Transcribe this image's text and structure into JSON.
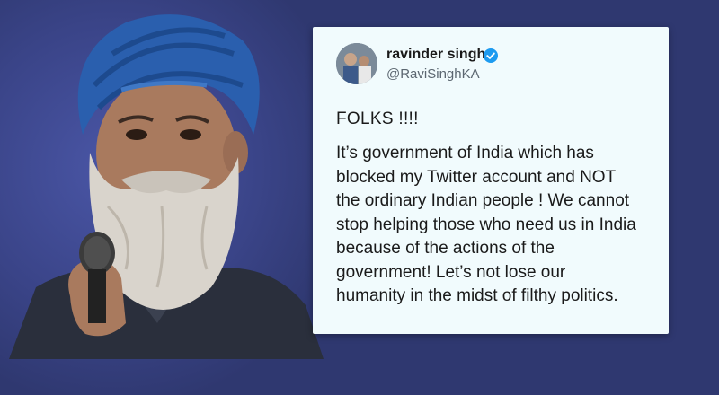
{
  "tweet": {
    "user_name": "ravinder singh",
    "handle": "@RaviSinghKA",
    "verified": true,
    "heading": "FOLKS !!!!",
    "body_lines": [
      "It’s government of India which has",
      "blocked my Twitter account and NOT",
      "the ordinary Indian people ! We cannot",
      "stop helping those who need us in India",
      "because of the actions of the",
      "government! Let’s not lose our",
      "humanity in the midst of filthy politics."
    ]
  },
  "colors": {
    "background": "#2f3870",
    "card": "#f1fbfd",
    "verified_badge": "#1d9bf0",
    "turban": "#2a5fae"
  }
}
